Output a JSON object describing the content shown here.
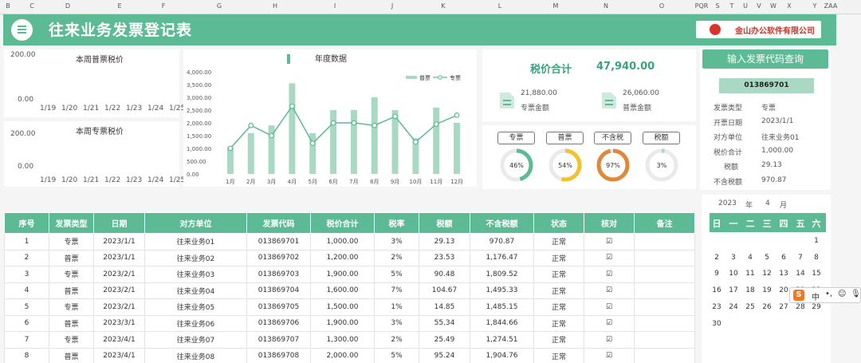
{
  "columns": [
    "B",
    "C",
    "D",
    "E",
    "F",
    "G",
    "H",
    "I",
    "J",
    "K",
    "L",
    "M",
    "N",
    "O",
    "PQR",
    "S",
    "T",
    "U",
    "V",
    "W",
    "X",
    "Y",
    "ZAA"
  ],
  "header": {
    "title": "往来业务发票登记表",
    "company": "金山办公软件有限公司"
  },
  "weekly_general": {
    "title": "本周普票税价",
    "ytop": "200.00",
    "ybottom": "0.00",
    "dates": [
      "1/19",
      "1/20",
      "1/21",
      "1/22",
      "1/23",
      "1/24",
      "1/25"
    ]
  },
  "weekly_special": {
    "title": "本周专票税价",
    "ytop": "200.00",
    "ybottom": "0.00",
    "dates": [
      "1/19",
      "1/20",
      "1/21",
      "1/22",
      "1/23",
      "1/24",
      "1/25"
    ]
  },
  "chart_data": {
    "type": "bar",
    "title": "年度数据",
    "categories": [
      "1月",
      "2月",
      "3月",
      "4月",
      "5月",
      "6月",
      "7月",
      "8月",
      "9月",
      "10月",
      "11月",
      "12月"
    ],
    "y_ticks": [
      "4,000.00",
      "3,500.00",
      "3,000.00",
      "2,500.00",
      "2,000.00",
      "1,500.00",
      "1,000.00",
      "500.00",
      "0.00"
    ],
    "ylim": [
      0,
      4000
    ],
    "series": [
      {
        "name": "普票",
        "type": "bar",
        "values": [
          1050,
          1600,
          1900,
          3550,
          1600,
          2500,
          2500,
          3000,
          2500,
          1400,
          2600,
          2000
        ]
      },
      {
        "name": "专票",
        "type": "line",
        "values": [
          1000,
          1900,
          1500,
          2650,
          1200,
          2000,
          2000,
          1900,
          2250,
          1250,
          1950,
          2300
        ]
      }
    ],
    "legend": "top-right",
    "colors": {
      "bar": "#a9d9c3",
      "line": "#5cba95"
    }
  },
  "kpi": {
    "label": "税价合计",
    "value": "47,940.00",
    "special_amount": "21,880.00",
    "special_label": "专票金额",
    "general_amount": "26,060.00",
    "general_label": "普票金额"
  },
  "gauges": [
    {
      "label": "专票",
      "percent": 46,
      "text": "46%",
      "color": "#5cba95"
    },
    {
      "label": "普票",
      "percent": 54,
      "text": "54%",
      "color": "#f2c12e"
    },
    {
      "label": "不含税",
      "percent": 97,
      "text": "97%",
      "color": "#e0873a"
    },
    {
      "label": "税额",
      "percent": 3,
      "text": "3%",
      "color": "#a9d9c3"
    }
  ],
  "query": {
    "button": "输入发票代码查询",
    "code": "013869701",
    "fields": [
      {
        "label": "发票类型",
        "value": "专票"
      },
      {
        "label": "开票日期",
        "value": "2023/1/1"
      },
      {
        "label": "对方单位",
        "value": "往来业务01"
      },
      {
        "label": "税价合计",
        "value": "1,000.00"
      },
      {
        "label": "税额",
        "value": "29.13"
      },
      {
        "label": "不含税额",
        "value": "970.87"
      }
    ]
  },
  "table": {
    "headers": [
      "序号",
      "发票类型",
      "日期",
      "对方单位",
      "发票代码",
      "税价合计",
      "税率",
      "税额",
      "不含税额",
      "状态",
      "核对",
      "备注"
    ],
    "rows": [
      [
        "1",
        "专票",
        "2023/1/1",
        "往来业务01",
        "013869701",
        "1,000.00",
        "3%",
        "29.13",
        "970.87",
        "正常",
        "☑",
        ""
      ],
      [
        "2",
        "普票",
        "2023/1/1",
        "往来业务02",
        "013869702",
        "1,200.00",
        "2%",
        "23.53",
        "1,176.47",
        "正常",
        "☑",
        ""
      ],
      [
        "3",
        "专票",
        "2023/2/1",
        "往来业务03",
        "013869703",
        "1,900.00",
        "5%",
        "90.48",
        "1,809.52",
        "正常",
        "☑",
        ""
      ],
      [
        "4",
        "普票",
        "2023/2/1",
        "往来业务04",
        "013869704",
        "1,600.00",
        "7%",
        "104.67",
        "1,495.33",
        "正常",
        "☑",
        ""
      ],
      [
        "5",
        "专票",
        "2023/2/1",
        "往来业务05",
        "013869705",
        "1,500.00",
        "1%",
        "14.85",
        "1,485.15",
        "正常",
        "☑",
        ""
      ],
      [
        "6",
        "普票",
        "2023/3/1",
        "往来业务06",
        "013869706",
        "1,900.00",
        "3%",
        "55.34",
        "1,844.66",
        "正常",
        "☑",
        ""
      ],
      [
        "7",
        "专票",
        "2023/4/1",
        "往来业务07",
        "013869707",
        "1,300.00",
        "2%",
        "25.49",
        "1,274.51",
        "正常",
        "☑",
        ""
      ],
      [
        "8",
        "普票",
        "2023/4/1",
        "往来业务08",
        "013869708",
        "2,000.00",
        "5%",
        "95.24",
        "1,904.76",
        "正常",
        "☑",
        ""
      ]
    ]
  },
  "calendar": {
    "year": "2023",
    "year_label": "年",
    "month": "4",
    "month_label": "月",
    "weekdays": [
      "日",
      "一",
      "二",
      "三",
      "四",
      "五",
      "六"
    ],
    "weeks": [
      [
        "",
        "",
        "",
        "",
        "",
        "",
        "1"
      ],
      [
        "2",
        "3",
        "4",
        "5",
        "6",
        "7",
        "8"
      ],
      [
        "9",
        "10",
        "11",
        "12",
        "13",
        "14",
        "15"
      ],
      [
        "16",
        "17",
        "18",
        "19",
        "20",
        "21",
        "22"
      ],
      [
        "23",
        "24",
        "25",
        "26",
        "27",
        "28",
        "29"
      ],
      [
        "30",
        "",
        "",
        "",
        "",
        "",
        ""
      ]
    ]
  },
  "ime": {
    "logo": "S",
    "mode": "中"
  }
}
